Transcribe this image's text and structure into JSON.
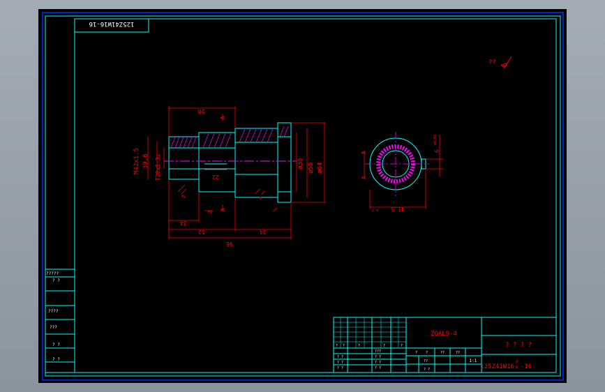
{
  "drawing": {
    "rotated_code": "125Z41W16-16",
    "roughness_symbol": "??",
    "part_name": "ZQAL9-4",
    "drawing_code": "125Z41W16",
    "drawing_code_superscript": "P",
    "drawing_code_subscript": "R",
    "drawing_code_suffix": "-16",
    "title_unknown": "? ? ? ?",
    "scale": "1:1"
  },
  "front_view": {
    "dims": {
      "top_50": "50",
      "m42": "M42x1.5",
      "d398": "39.8",
      "t28": "T28x5-3z",
      "d30": "ø30",
      "d50": "ø50",
      "d64": "ø64",
      "d22": "22",
      "d24": "24",
      "d52": "52",
      "d34": "34",
      "d96": "96",
      "d2": "2",
      "d3": "3",
      "d6": "6"
    },
    "section_marks": [
      "A",
      "A"
    ]
  },
  "side_view": {
    "dims": {
      "d415": "41.5",
      "d415_tol": "-0.2",
      "d6": "6",
      "d6_tol": "+0.03"
    },
    "section_marks": [
      "A",
      "A"
    ]
  },
  "left_table": {
    "rows": [
      "?????",
      "?  ?",
      "????",
      "???",
      "?  ?",
      "?  ?"
    ]
  },
  "title_block": {
    "grid_labels": [
      "?",
      "?",
      "?",
      "?",
      "?",
      "?",
      "?",
      "??",
      "??"
    ],
    "bottom_labels": [
      "? ?",
      "? ?",
      "? ?",
      "??",
      "? ?"
    ],
    "mid_labels": [
      "? ?",
      "? ?",
      "? ?",
      "???"
    ]
  },
  "colors": {
    "frame": "#00ffff",
    "dimension": "#ff0000",
    "outline": "#00ffff",
    "hatch": "#ff00ff",
    "center": "#ff00ff",
    "solid": "#00ff00",
    "background": "#000000"
  }
}
